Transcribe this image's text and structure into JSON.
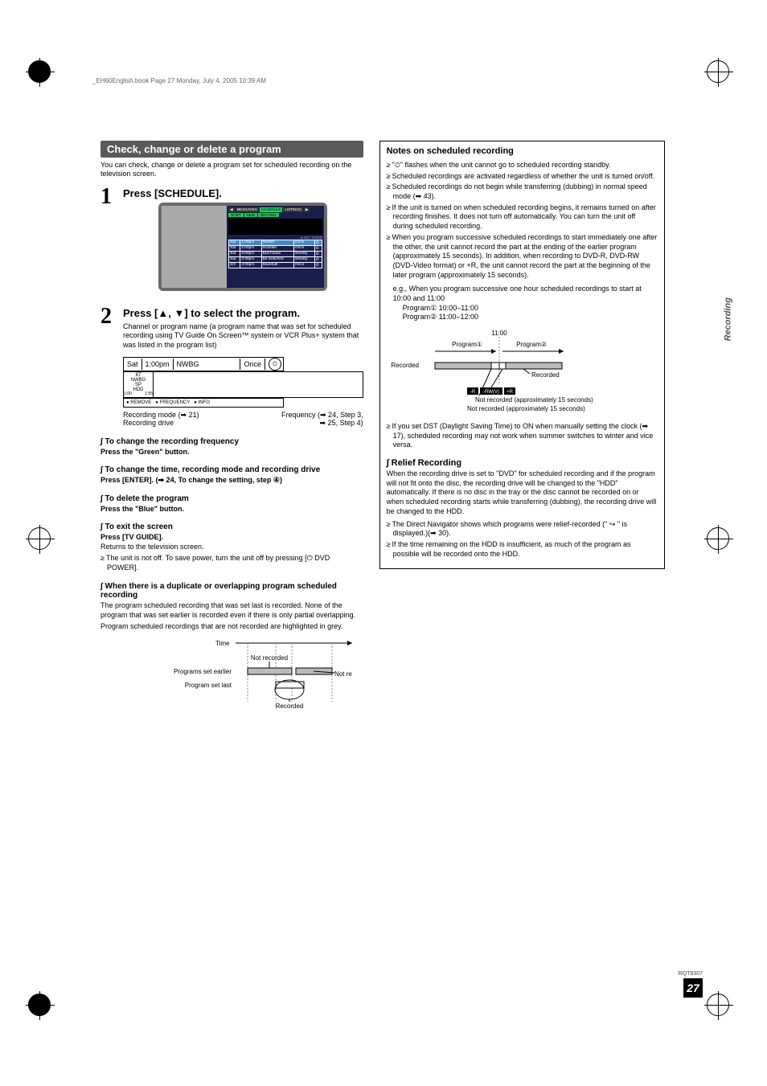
{
  "header_note": "_EH60English.book  Page 27  Monday, July 4, 2005  10:39 AM",
  "side_tab": "Recording",
  "page_ref": "RQT8307",
  "page_number": "27",
  "left": {
    "banner": "Check, change or delete a program",
    "intro": "You can check, change or delete a program set for scheduled recording on the television screen.",
    "step1": {
      "title": "Press [SCHEDULE].",
      "tv": {
        "tabs": [
          "MESSAGES",
          "SCHEDULE",
          "LISTINGS"
        ],
        "sort": [
          "SORT",
          "NEW",
          "RECORD"
        ],
        "hint": "●:SET TIMER",
        "rows": [
          [
            "Sat",
            "1:00pm",
            "NWBG",
            "Once",
            "⏲"
          ],
          [
            "Sat",
            "2:00pm",
            "Dodzilla",
            "Once",
            "⏲"
          ],
          [
            "Sat",
            "3:00pm",
            "Bull house",
            "Weekly",
            "⏲"
          ],
          [
            "Sat",
            "3:30pm",
            "Be switched",
            "Weekly",
            "⏲"
          ],
          [
            "4/3",
            "4:00pm",
            "Baseball",
            "Once",
            "⏲"
          ]
        ]
      }
    },
    "step2": {
      "title": "Press [▲, ▼] to select the program.",
      "desc": "Channel or program name (a program name that was set for scheduled recording using TV Guide On Screen™ system or VCR Plus+ system that was listed in the program list)",
      "row": {
        "day": "Sat",
        "time": "1:00pm",
        "ch": "NWBG",
        "freq": "Once"
      },
      "left_box": [
        "87",
        "NWBG",
        "SP",
        "HDD",
        "1:00",
        "1:55"
      ],
      "bottom": [
        "● REMOVE",
        "● FREQUENCY",
        "● INFO"
      ],
      "callout_l1": "Recording mode (➡ 21)",
      "callout_l2": "Recording drive",
      "callout_r1": "Frequency (➡ 24, Step 3,",
      "callout_r2": "➡ 25, Step 4)"
    },
    "h_freq": "To change the recording frequency",
    "h_freq_line": "Press the \"Green\" button.",
    "h_time": "To change the time, recording mode and recording drive",
    "h_time_line": "Press [ENTER]. (➡ 24, To change the setting, step ④)",
    "h_del": "To delete the program",
    "h_del_line": "Press the \"Blue\" button.",
    "h_exit": "To exit the screen",
    "h_exit_line": "Press [TV GUIDE].",
    "exit_p1": "Returns to the television screen.",
    "exit_b1": "The unit is not off. To save power, turn the unit off by pressing [⏻ DVD POWER].",
    "h_dup": "When there is a duplicate or overlapping program scheduled recording",
    "dup_p1": "The program scheduled recording that was set last is recorded. None of the program that was set earlier is recorded even if there is only partial overlapping.",
    "dup_p2": "Program scheduled recordings that are not recorded are highlighted in grey.",
    "diagram": {
      "time": "Time",
      "earlier": "Programs set earlier",
      "last": "Program set last",
      "not_rec": "Not recorded",
      "recorded": "Recorded"
    }
  },
  "right": {
    "title": "Notes on scheduled recording",
    "b1": "\"⏲\" flashes when the unit cannot go to scheduled recording standby.",
    "b2": "Scheduled recordings are activated regardless of whether the unit is turned on/off.",
    "b3": "Scheduled recordings do not begin while transferring (dubbing) in normal speed mode (➡ 43).",
    "b4": "If the unit is turned on when scheduled recording begins, it remains turned on after recording finishes. It does not turn off automatically. You can turn the unit off during scheduled recording.",
    "b5": "When you program successive scheduled recordings to start immediately one after the other, the unit cannot record the part at the ending of the earlier program (approximately 15 seconds). In addition, when recording to DVD-R, DVD-RW (DVD-Video format) or +R, the unit cannot record the part at the beginning of the later program (approximately 15 seconds).",
    "ex_lead": "e.g., When you program successive one hour scheduled recordings to start at 10:00 and 11:00",
    "ex_p1": "Program① 10:00–11:00",
    "ex_p2": "Program② 11:00–12:00",
    "diag2": {
      "time": "11:00",
      "p1": "Program①",
      "p2": "Program②",
      "recorded": "Recorded",
      "badges": [
        "-R",
        "-RW(V)",
        "+R"
      ],
      "note1": "Not recorded (approximately 15 seconds)",
      "note2": "Not recorded (approximately 15 seconds)"
    },
    "b6": "If you set DST (Daylight Saving Time) to ON when manually setting the clock (➡ 17), scheduled recording may not work when summer switches to winter and vice versa.",
    "h_relief": "Relief Recording",
    "relief_p": "When the recording drive is set to \"DVD\" for scheduled recording and if the program will not fit onto the disc, the recording drive will be changed to the \"HDD\" automatically. If there is no disc in the tray or the disc cannot be recorded on or when scheduled recording starts while transferring (dubbing), the recording drive will be changed to the HDD.",
    "relief_b1": "The Direct Navigator shows which programs were relief-recorded (\" ↪ \" is displayed.)(➡ 30).",
    "relief_b2": "If the time remaining on the HDD is insufficient, as much of the program as possible will be recorded onto the HDD."
  }
}
